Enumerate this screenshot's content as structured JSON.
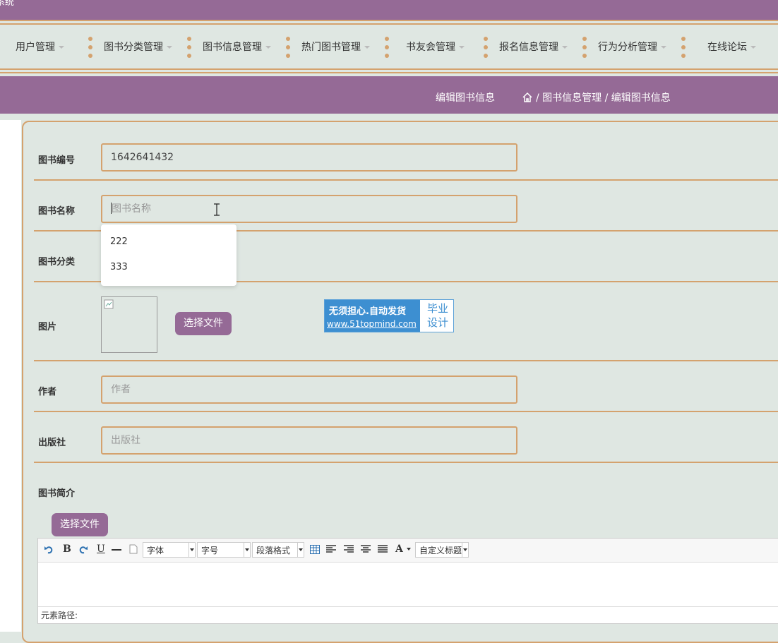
{
  "app": {
    "title_fragment": "系统"
  },
  "nav": {
    "items": [
      {
        "label": "用户管理"
      },
      {
        "label": "图书分类管理"
      },
      {
        "label": "图书信息管理"
      },
      {
        "label": "热门图书管理"
      },
      {
        "label": "书友会管理"
      },
      {
        "label": "报名信息管理"
      },
      {
        "label": "行为分析管理"
      },
      {
        "label": "在线论坛"
      }
    ]
  },
  "header": {
    "title": "编辑图书信息",
    "breadcrumb": {
      "sep": "/",
      "level1": "图书信息管理",
      "level2": "编辑图书信息"
    }
  },
  "form": {
    "book_no": {
      "label": "图书编号",
      "value": "1642641432"
    },
    "book_name": {
      "label": "图书名称",
      "placeholder": "图书名称"
    },
    "suggestions": [
      "222",
      "333"
    ],
    "category": {
      "label": "图书分类"
    },
    "image": {
      "label": "图片",
      "button": "选择文件"
    },
    "author": {
      "label": "作者",
      "placeholder": "作者"
    },
    "publisher": {
      "label": "出版社",
      "placeholder": "出版社"
    },
    "intro": {
      "label": "图书简介",
      "button": "选择文件"
    }
  },
  "promo": {
    "line1": "无须担心.自动发货",
    "line2": "www.51topmind.com",
    "right_line1": "毕业",
    "right_line2": "设计"
  },
  "editor": {
    "font_select": "字体",
    "size_select": "字号",
    "para_select": "段落格式",
    "custom_select": "自定义标题",
    "bold": "B",
    "underline": "U",
    "font_color": "A",
    "status": "元素路径:"
  },
  "colors": {
    "purple": "#956a96",
    "accent": "#d4a26e",
    "background": "#dfe7e2",
    "promo_blue": "#3d8fd1"
  }
}
